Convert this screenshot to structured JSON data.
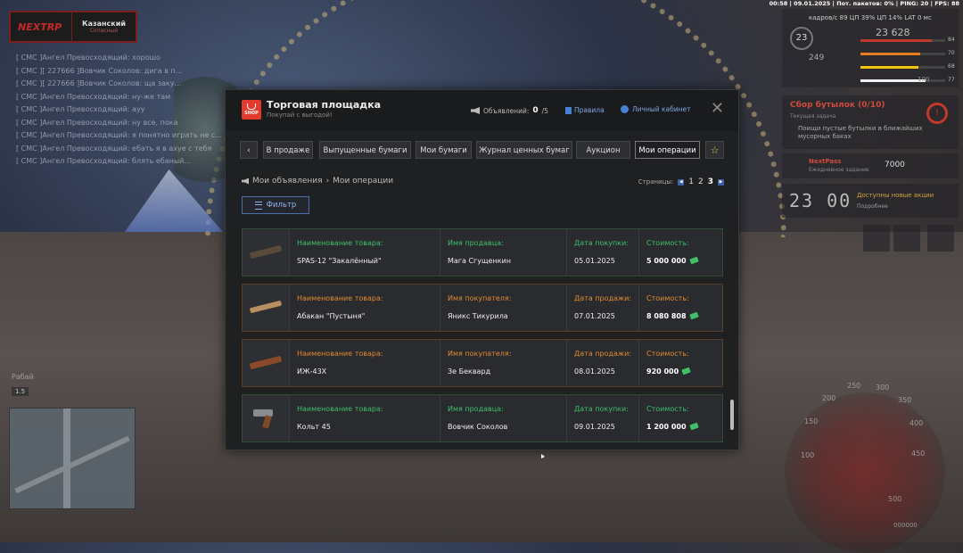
{
  "hud": {
    "status_line": "00:58 | 09.01.2025 | Пот. пакетов: 0% | PING: 20 | FPS: 88",
    "fps_row": "кадров/с   89   ЦП  39%   ЦП  14%  LAT  0 мс",
    "level": "23",
    "money": "23 628",
    "armor_value": "249",
    "bars": [
      {
        "value": "84",
        "color": "#c0392b",
        "fill": 0.84
      },
      {
        "value": "70",
        "color": "#e67e22",
        "fill": 0.7
      },
      {
        "value": "68",
        "color": "#f1c40f",
        "fill": 0.68
      },
      {
        "value": "77",
        "color": "#ecf0f1",
        "fill": 0.77
      }
    ],
    "bar100": "100",
    "quest_title": "Сбор бутылок (0/10)",
    "quest_sub": "Текущая задача",
    "quest_desc": "Поищи пустые бутылки в ближайших мусорных баках",
    "nextpass_title": "NextPass",
    "nextpass_sub": "Ежедневное задание",
    "nextpass_value": "7000",
    "timer_clock": "23 00",
    "timer_title": "Доступны новые акции",
    "timer_sub": "Подробнее",
    "map_label": "Рабай",
    "map_zoom": "1.5"
  },
  "logo": {
    "brand": "NEXTRP",
    "server": "Казанский",
    "server_sub": "Сопасный"
  },
  "chat": [
    "[ СМС ]Ангел Превосходящий: хорошо",
    "[ СМС ][ 227666 ]Вовчик Соколов: дига в п...",
    "[ СМС ][ 227666 ]Вовчик Соколов: ща заку...",
    "[ СМС ]Ангел Превосходящий: ну-же там",
    "[ СМС ]Ангел Превосходящий: ауу",
    "[ СМС ]Ангел Превосходящий: ну все, пока",
    "[ СМС ]Ангел Превосходящий: я понятно играть не с...",
    "[ СМС ]Ангел Превосходящий: ебать я в ахуе с тебя",
    "[ СМС ]Ангел Превосходящий: блять ебаный..."
  ],
  "speedo": {
    "nums": [
      "250",
      "300",
      "200",
      "350",
      "150",
      "400",
      "100",
      "450",
      "500"
    ],
    "odo": "000000"
  },
  "dialog": {
    "title": "Торговая площадка",
    "subtitle": "Покупай с выгодой!",
    "shop_badge": "SHOP",
    "ads_label": "Объявлений:",
    "ads_count": "0",
    "ads_max": "/5",
    "rules": "Правила",
    "cabinet": "Личный кабинет",
    "close": "✕",
    "back": "‹",
    "tabs": [
      "В продаже",
      "Выпущенные бумаги",
      "Мои бумаги",
      "Журнал ценных бумаг",
      "Аукцион",
      "Мои операции"
    ],
    "star": "☆",
    "crumb1": "Мои объявления",
    "crumb_sep": "›",
    "crumb2": "Мои операции",
    "pages_label": "Страницы:",
    "pages": [
      "1",
      "2",
      "3"
    ],
    "filter": "Фильтр",
    "items": [
      {
        "kind": "buy",
        "name_label": "Наименование товара:",
        "name": "SPAS-12 \"Закалённый\"",
        "party_label": "Имя продавца:",
        "party": "Мага Сгущенкин",
        "date_label": "Дата покупки:",
        "date": "05.01.2025",
        "price_label": "Стоимость:",
        "price": "5 000 000"
      },
      {
        "kind": "sell",
        "name_label": "Наименование товара:",
        "name": "Абакан \"Пустыня\"",
        "party_label": "Имя покупателя:",
        "party": "Яникс Тикурила",
        "date_label": "Дата продажи:",
        "date": "07.01.2025",
        "price_label": "Стоимость:",
        "price": "8 080 808"
      },
      {
        "kind": "sell",
        "name_label": "Наименование товара:",
        "name": "ИЖ-43Х",
        "party_label": "Имя покупателя:",
        "party": "Зе Беквард",
        "date_label": "Дата продажи:",
        "date": "08.01.2025",
        "price_label": "Стоимость:",
        "price": "920 000"
      },
      {
        "kind": "buy",
        "name_label": "Наименование товара:",
        "name": "Кольт 45",
        "party_label": "Имя продавца:",
        "party": "Вовчик Соколов",
        "date_label": "Дата покупки:",
        "date": "09.01.2025",
        "price_label": "Стоимость:",
        "price": "1 200 000"
      }
    ]
  }
}
